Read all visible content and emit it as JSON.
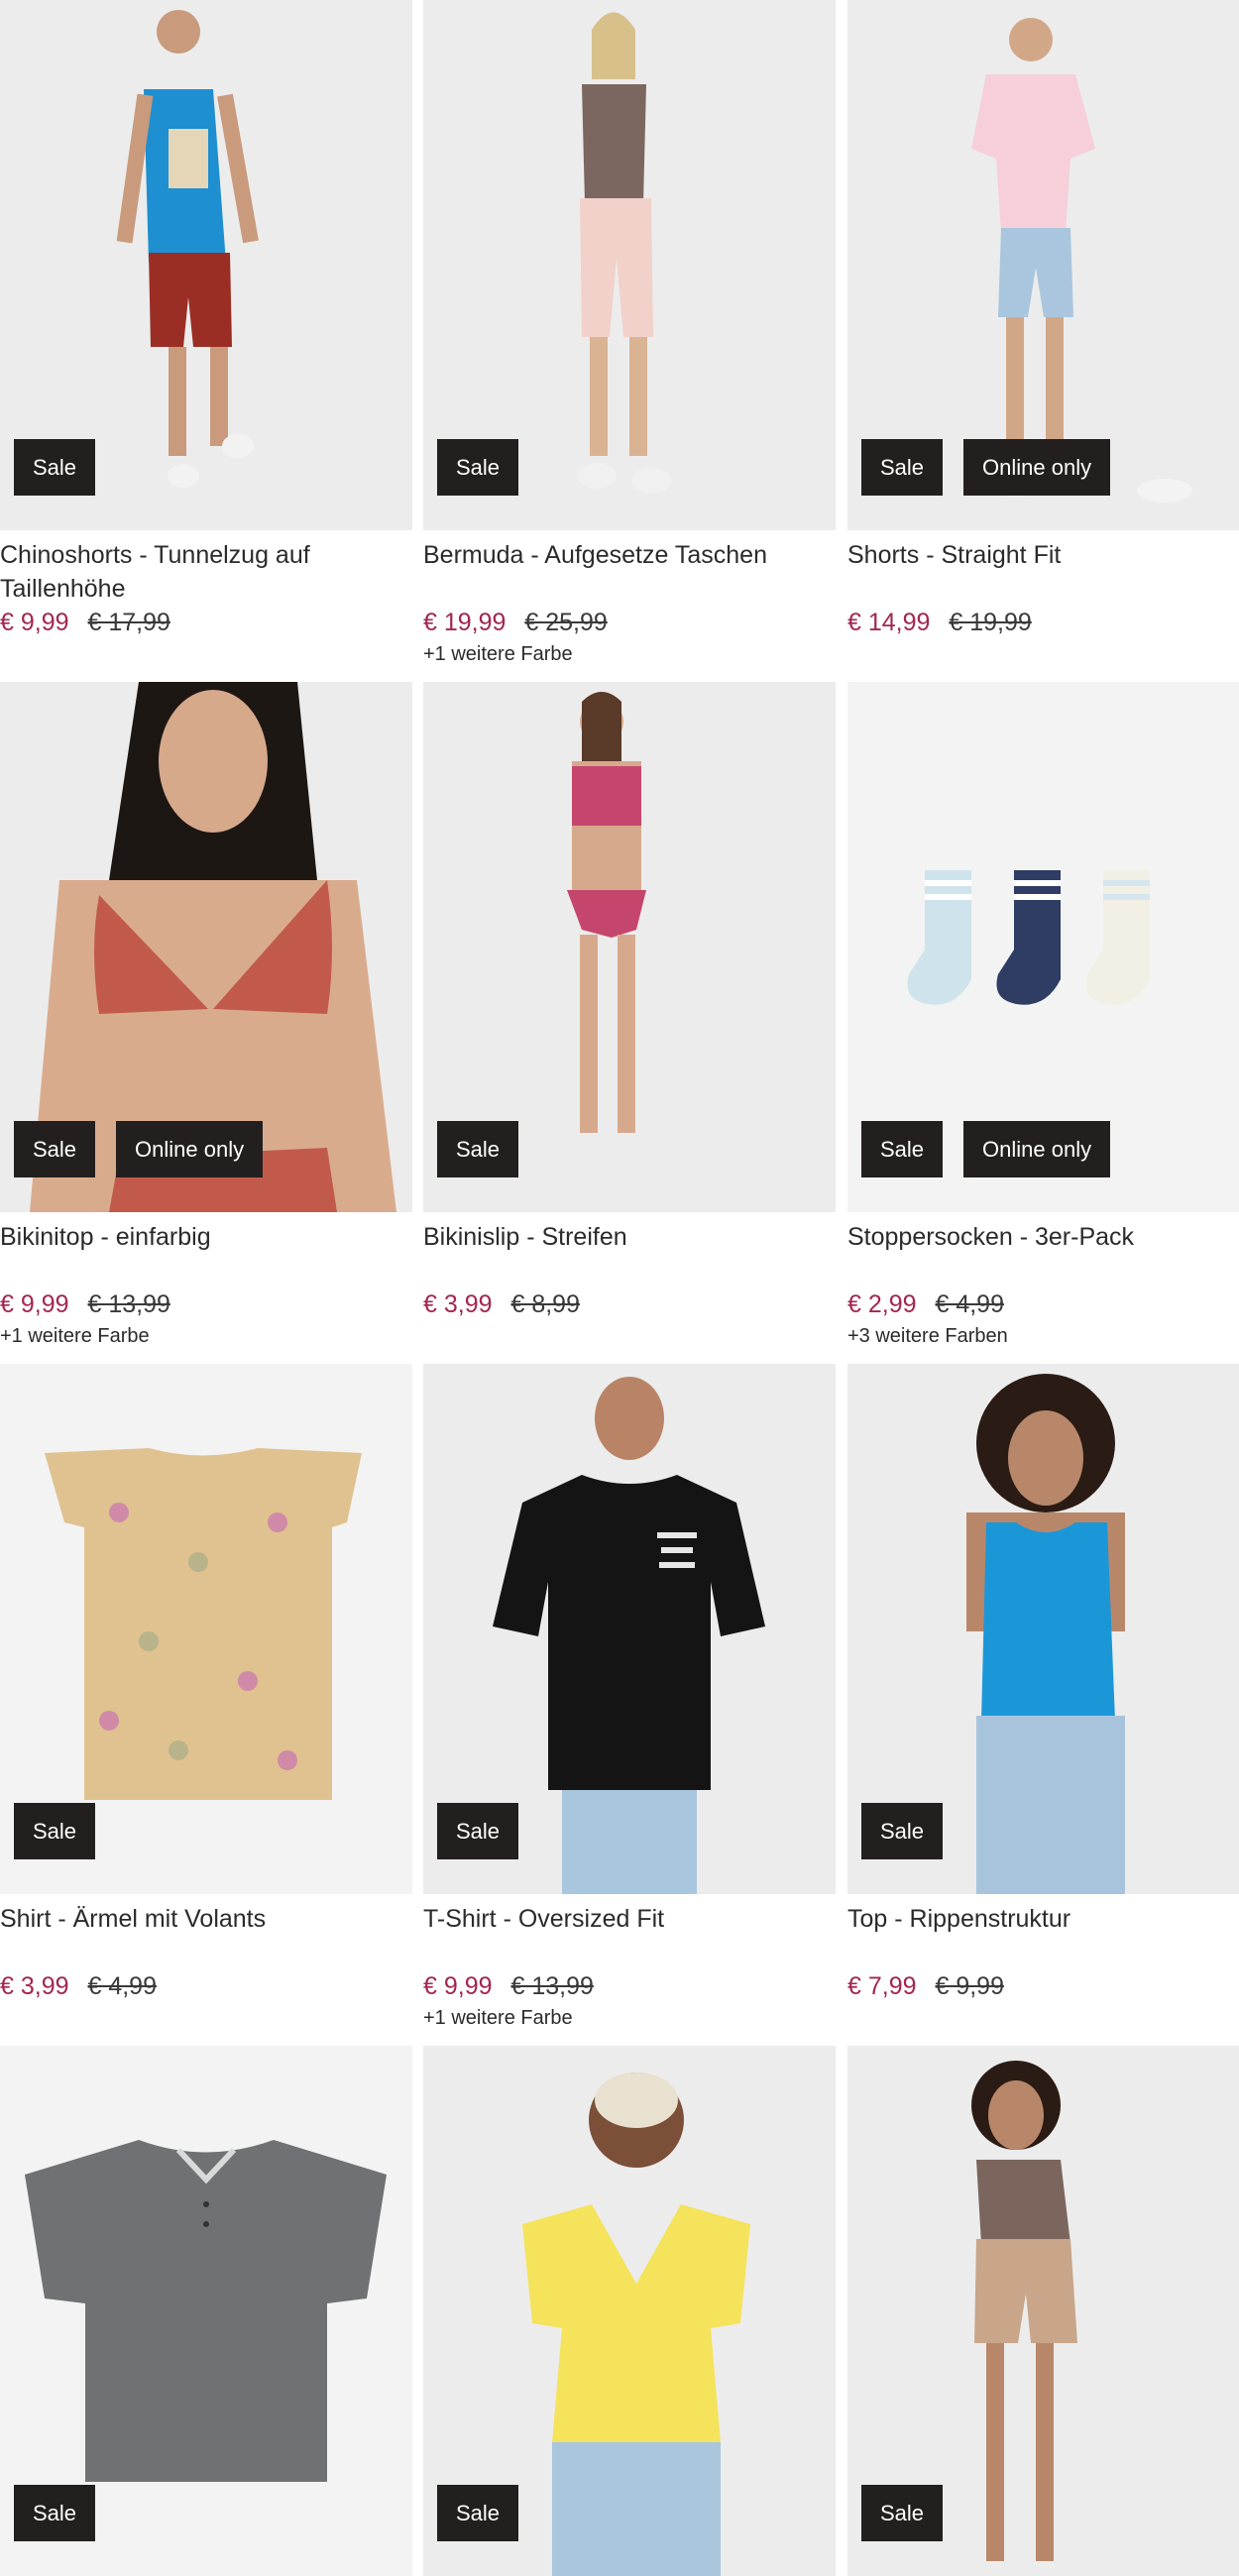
{
  "currency": "€",
  "products": [
    {
      "title": "Chinoshorts - Tunnelzug auf Taillenhöhe",
      "price": "€ 9,99",
      "old_price": "€ 17,99",
      "badges": [
        "Sale"
      ],
      "more": "",
      "image": "man-tanktop-red-shorts"
    },
    {
      "title": "Bermuda - Aufgesetze Taschen",
      "price": "€ 19,99",
      "old_price": "€ 25,99",
      "badges": [
        "Sale"
      ],
      "more": "+1 weitere Farbe",
      "image": "woman-pink-bermuda"
    },
    {
      "title": "Shorts - Straight Fit",
      "price": "€ 14,99",
      "old_price": "€ 19,99",
      "badges": [
        "Sale",
        "Online only"
      ],
      "more": "",
      "image": "woman-denim-shorts"
    },
    {
      "title": "Bikinitop - einfarbig",
      "price": "€ 9,99",
      "old_price": "€ 13,99",
      "badges": [
        "Sale",
        "Online only"
      ],
      "more": "+1 weitere Farbe",
      "image": "woman-bikinitop"
    },
    {
      "title": "Bikinislip - Streifen",
      "price": "€ 3,99",
      "old_price": "€ 8,99",
      "badges": [
        "Sale"
      ],
      "more": "",
      "image": "woman-pink-bikini"
    },
    {
      "title": "Stoppersocken - 3er-Pack",
      "price": "€ 2,99",
      "old_price": "€ 4,99",
      "badges": [
        "Sale",
        "Online only"
      ],
      "more": "+3 weitere Farben",
      "image": "socks-3-pack"
    },
    {
      "title": "Shirt - Ärmel mit Volants",
      "price": "€ 3,99",
      "old_price": "€ 4,99",
      "badges": [
        "Sale"
      ],
      "more": "",
      "image": "kids-shirt-print"
    },
    {
      "title": "T-Shirt - Oversized Fit",
      "price": "€ 9,99",
      "old_price": "€ 13,99",
      "badges": [
        "Sale"
      ],
      "more": "+1 weitere Farbe",
      "image": "man-black-tshirt"
    },
    {
      "title": "Top - Rippenstruktur",
      "price": "€ 7,99",
      "old_price": "€ 9,99",
      "badges": [
        "Sale"
      ],
      "more": "",
      "image": "woman-blue-top"
    },
    {
      "title": "",
      "price": "",
      "old_price": "",
      "badges": [
        "Sale"
      ],
      "more": "",
      "image": "grey-henley-shirt"
    },
    {
      "title": "",
      "price": "",
      "old_price": "",
      "badges": [
        "Sale"
      ],
      "more": "",
      "image": "woman-yellow-top"
    },
    {
      "title": "",
      "price": "",
      "old_price": "",
      "badges": [
        "Sale"
      ],
      "more": "",
      "image": "woman-brown-top-shorts"
    }
  ],
  "colors": {
    "sale_price": "#a3264f",
    "badge_bg": "#231f1e",
    "badge_text": "#ffffff",
    "image_bg": "#ececec"
  }
}
